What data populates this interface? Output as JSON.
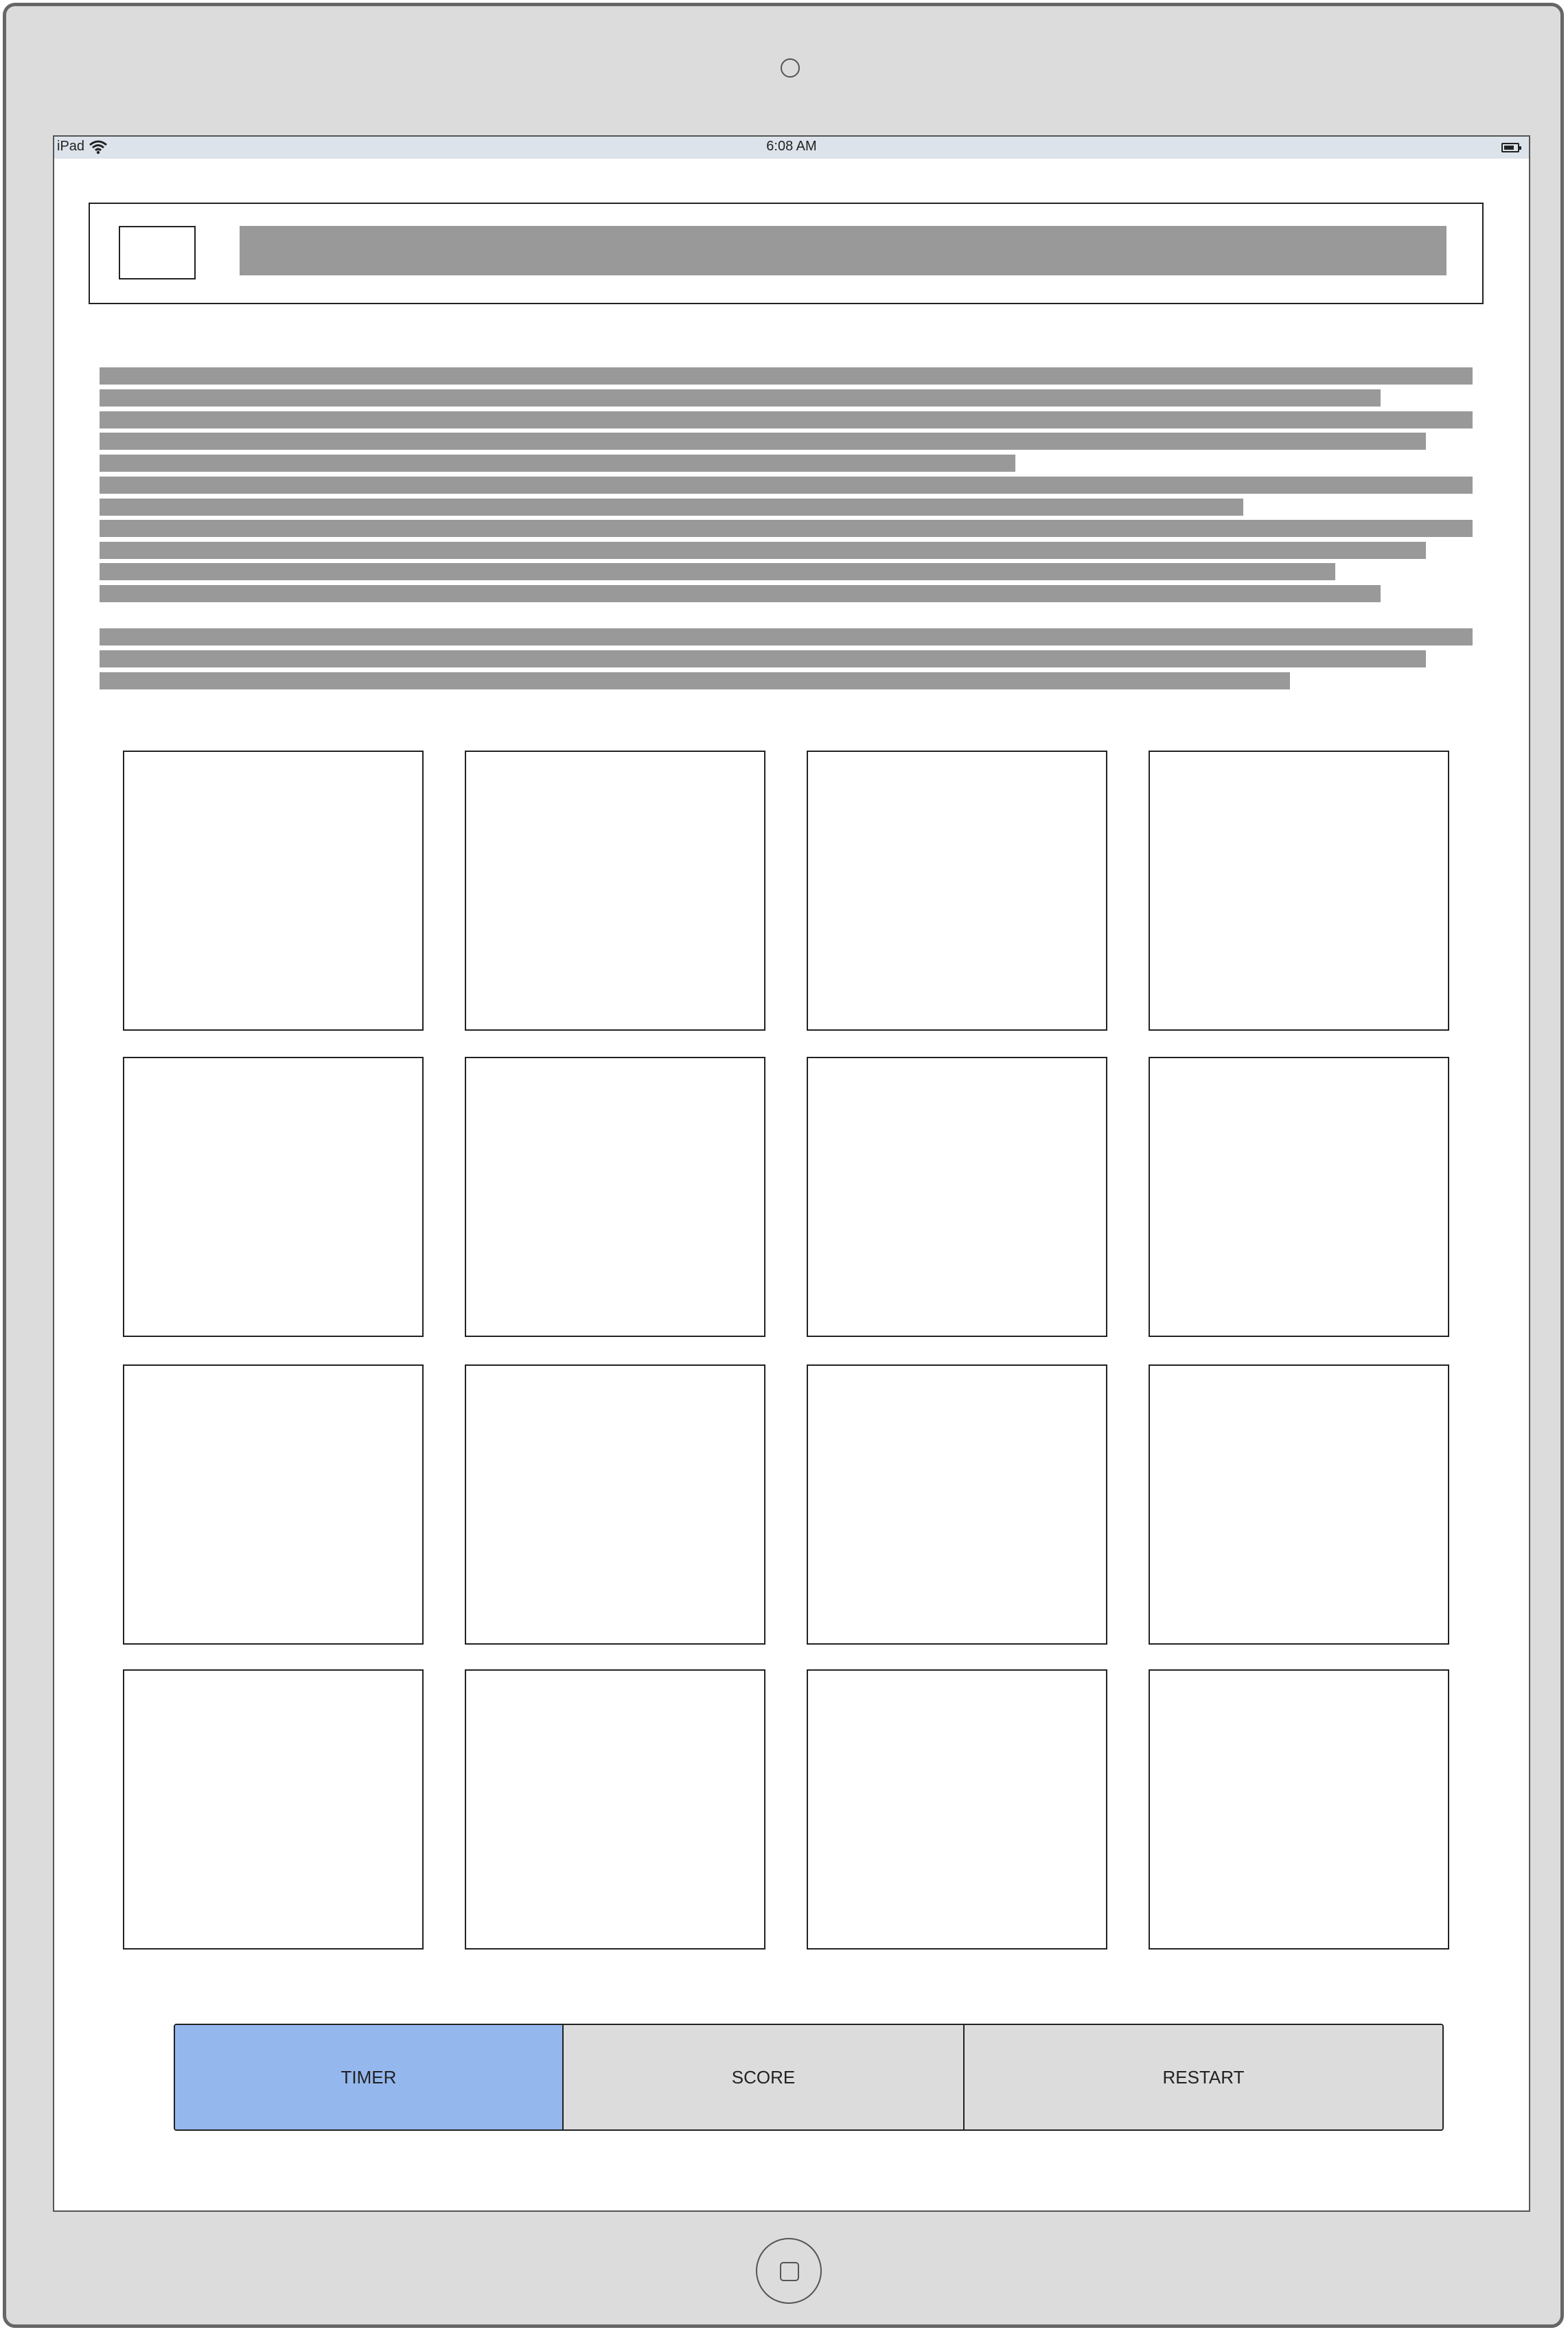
{
  "status_bar": {
    "carrier": "iPad",
    "time": "6:08 AM"
  },
  "toolbar": {
    "timer_label": "TIMER",
    "score_label": "SCORE",
    "restart_label": "RESTART",
    "active_button": "TIMER"
  },
  "colors": {
    "active_button": "#94b8ee",
    "button_background": "#dcdcdc",
    "placeholder_bar": "#999999",
    "device_frame": "#dcdcdc"
  },
  "grid": {
    "rows": 4,
    "columns": 4
  }
}
